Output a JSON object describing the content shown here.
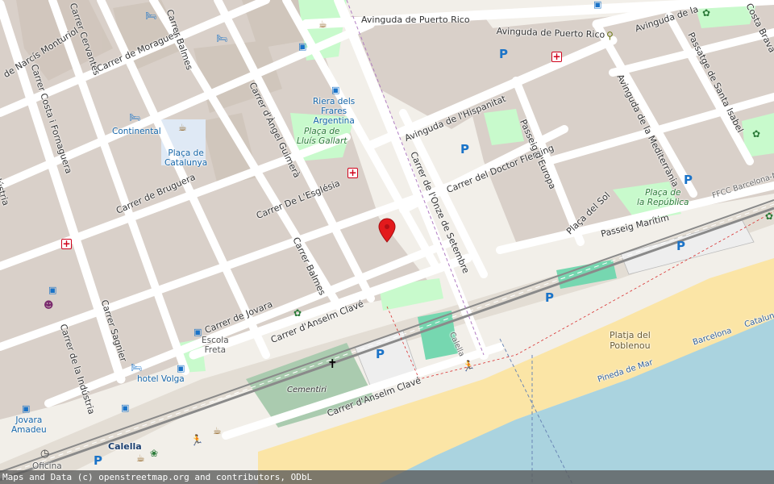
{
  "streets": {
    "narcis_monturiol": "de Narcís Monturiol",
    "cervantes": "Carrer Cervantes",
    "moragues": "Carrer de Moragues",
    "balmes_top": "Carrer Balmes",
    "angel_guimera": "Carrer d'Àngel Guimerà",
    "costa_fornaguera": "Carrer Costa i Fornaguera",
    "industria_left": "dústria",
    "bruguera": "Carrer de Bruguera",
    "esglesia": "Carrer De L'Església",
    "balmes_mid": "Carrer Balmes",
    "sagnier": "Carrer Sagnier",
    "industria": "Carrer de la Indústria",
    "jovara": "Carrer de Jovara",
    "anselm_clave_1": "Carrer d'Anselm Clavé",
    "anselm_clave_2": "Carrer d'Anselm Clavé",
    "puerto_rico_1": "Avinguda de Puerto Rico",
    "puerto_rico_2": "Avinguda de Puerto Rico",
    "puerto_rico_3": "Avinguda de la",
    "passatge_santa_isabel": "Passatge de Santa Isabel",
    "costa_brava": "Costa Brava",
    "hispanitat": "Avinguda de l'Hispanitat",
    "mediterrania": "Avinguda de la Mediterrània",
    "doctor_fleming": "Carrer del Doctor Fleming",
    "onze_setembre": "Carrer de l'Onze de Setembre",
    "passeig_europa": "Passeig d'Europa",
    "placa_sol": "Plaça del Sol",
    "passeig_maritim": "Passeig Marítim"
  },
  "pois": {
    "riera": "Riera dels\nFrares\nArgentina",
    "lluis_gallart": "Plaça de\nLluís Gallart",
    "continental": "Continental",
    "catalunya": "Plaça de\nCatalunya",
    "republica": "Plaça de\nla República",
    "escola_freta": "Escola\nFreta",
    "hotel_volga": "hotel Volga",
    "jovara_amadeu": "Jovara\nAmadeu",
    "calella": "Calella",
    "oficina": "Oficina",
    "cementiri": "Cementiri",
    "calella_station": "Calella"
  },
  "rail": {
    "ffcc": "FFCC Barcelona-M",
    "barcelona": "Barcelona",
    "catalunya": "Cataluny"
  },
  "beach": {
    "name": "Platja del\nPoblenou",
    "pineda": "Pineda de Mar"
  },
  "icons": {
    "parking": "P",
    "pharmacy": "+",
    "bus": "bus-stop-icon",
    "cafe": "cafe-icon",
    "hotel": "hotel-icon",
    "cross": "✝",
    "marker": "location-marker-icon"
  },
  "colors": {
    "land": "#f2efe9",
    "block": "#d9d0c9",
    "road": "#ffffff",
    "park": "#c8facc",
    "beach": "#fbe5a6",
    "sea": "#aad3df",
    "rail": "#777777",
    "marker": "#e31a1c"
  },
  "attribution": "Maps and Data (c) openstreetmap.org and contributors, ODbL"
}
